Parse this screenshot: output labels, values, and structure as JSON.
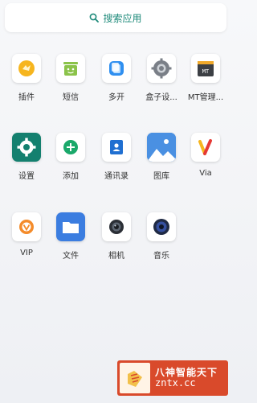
{
  "search": {
    "label": "搜索应用"
  },
  "apps": [
    {
      "name": "app-plugins",
      "label": "插件"
    },
    {
      "name": "app-sms",
      "label": "短信"
    },
    {
      "name": "app-multi-open",
      "label": "多开"
    },
    {
      "name": "app-box-settings",
      "label": "盒子设..."
    },
    {
      "name": "app-mt-manager",
      "label": "MT管理..."
    },
    {
      "name": "app-settings",
      "label": "设置"
    },
    {
      "name": "app-add",
      "label": "添加"
    },
    {
      "name": "app-contacts",
      "label": "通讯录"
    },
    {
      "name": "app-gallery",
      "label": "图库"
    },
    {
      "name": "app-via",
      "label": "Via"
    },
    {
      "name": "app-vip",
      "label": "VIP"
    },
    {
      "name": "app-files",
      "label": "文件"
    },
    {
      "name": "app-camera",
      "label": "相机"
    },
    {
      "name": "app-music",
      "label": "音乐"
    }
  ],
  "watermark": {
    "title": "八神智能天下",
    "domain": "zntx.cc"
  },
  "colors": {
    "accent": "#1e8a7a",
    "watermark_bg": "#d94a2b"
  }
}
